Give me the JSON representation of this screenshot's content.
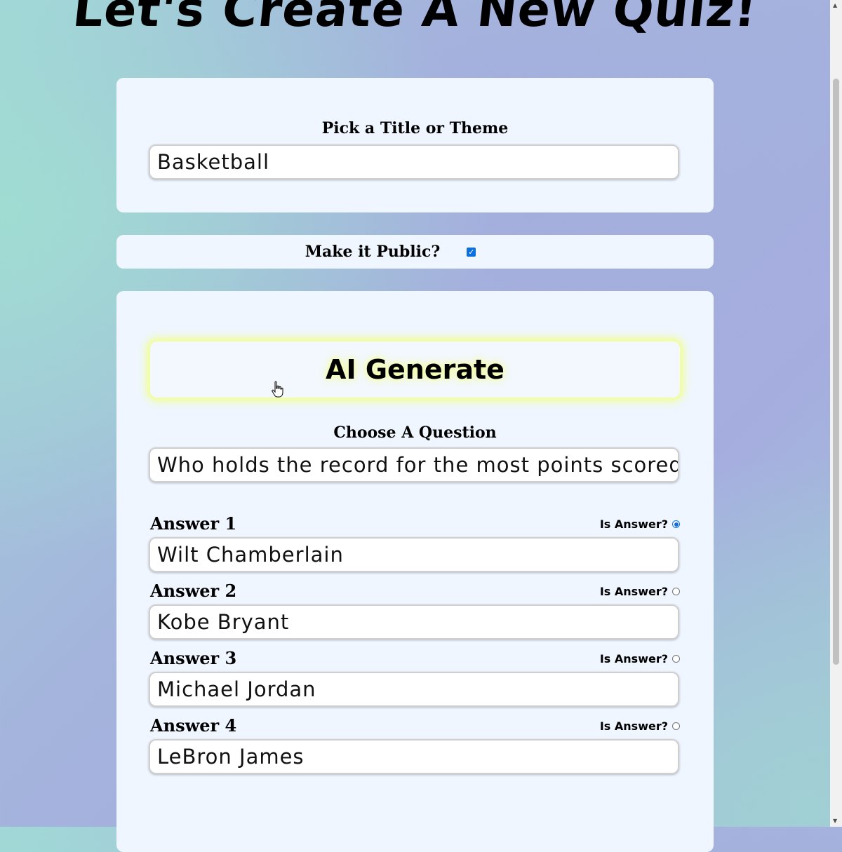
{
  "page": {
    "title": "Let's Create A New Quiz!"
  },
  "title_section": {
    "label": "Pick a Title or Theme",
    "value": "Basketball"
  },
  "public_section": {
    "label": "Make it Public?",
    "checked": true
  },
  "main": {
    "ai_button_label": "AI Generate",
    "question_label": "Choose A Question",
    "question_value": "Who holds the record for the most points scored",
    "is_answer_label": "Is Answer?",
    "answers": [
      {
        "label": "Answer 1",
        "value": "Wilt Chamberlain",
        "is_answer": true
      },
      {
        "label": "Answer 2",
        "value": "Kobe Bryant",
        "is_answer": false
      },
      {
        "label": "Answer 3",
        "value": "Michael Jordan",
        "is_answer": false
      },
      {
        "label": "Answer 4",
        "value": "LeBron James",
        "is_answer": false
      }
    ]
  },
  "colors": {
    "card_bg": "#eff6ff",
    "accent_blue": "#0b6fe0",
    "glow": "#f0fd9e"
  },
  "icons": [
    "check-icon",
    "hand-pointer-icon",
    "scroll-up-arrow-icon",
    "scroll-down-arrow-icon"
  ]
}
